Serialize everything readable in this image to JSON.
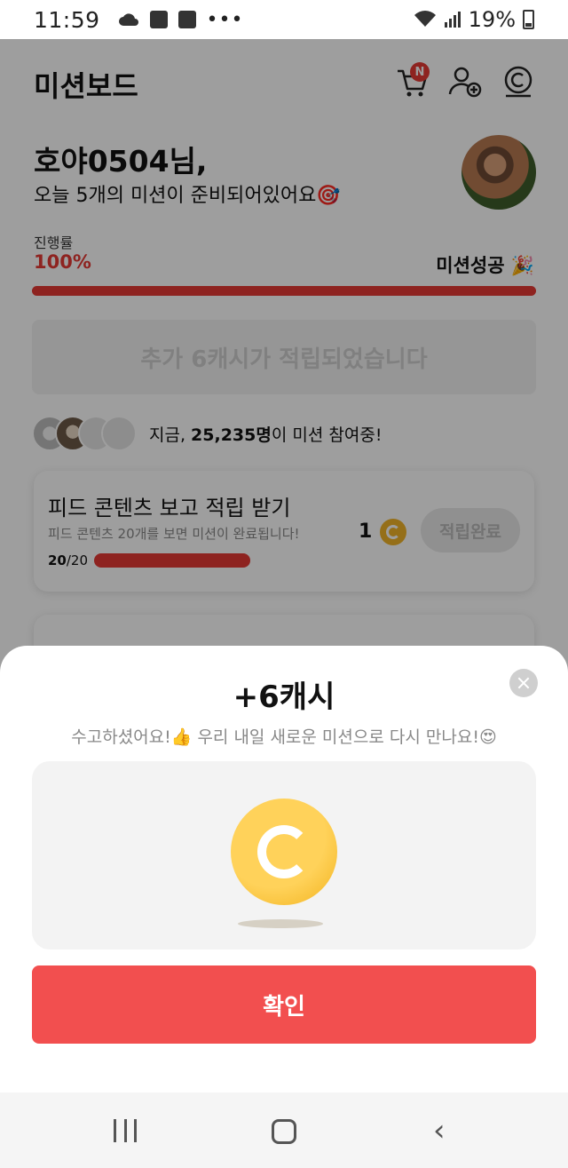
{
  "status_bar": {
    "time": "11:59",
    "battery": "19%"
  },
  "header": {
    "title": "미션보드",
    "cart_badge": "N"
  },
  "profile": {
    "greeting": "호야0504님,",
    "subtext": "오늘 5개의 미션이 준비되어있어요🎯"
  },
  "progress": {
    "label": "진행률",
    "value_text": "100%",
    "value": 1.0,
    "status": "미션성공 🎉"
  },
  "extra_cash_banner": "추가 6캐시가 적립되었습니다",
  "participants": {
    "prefix": "지금, ",
    "count": "25,235명",
    "suffix": "이 미션 참여중!"
  },
  "mission": {
    "title": "피드 콘텐츠 보고 적립 받기",
    "description": "피드 콘텐츠 20개를 보면 미션이 완료됩니다!",
    "progress_done": "20",
    "progress_total": "/20",
    "reward": "1",
    "button": "적립완료"
  },
  "popup": {
    "title": "+6캐시",
    "message": "수고하셨어요!👍 우리 내일 새로운 미션으로 다시 만나요!😍",
    "confirm": "확인"
  },
  "colors": {
    "accent": "#e53935",
    "confirm": "#f24f4f",
    "coin": "#f2b21c"
  }
}
